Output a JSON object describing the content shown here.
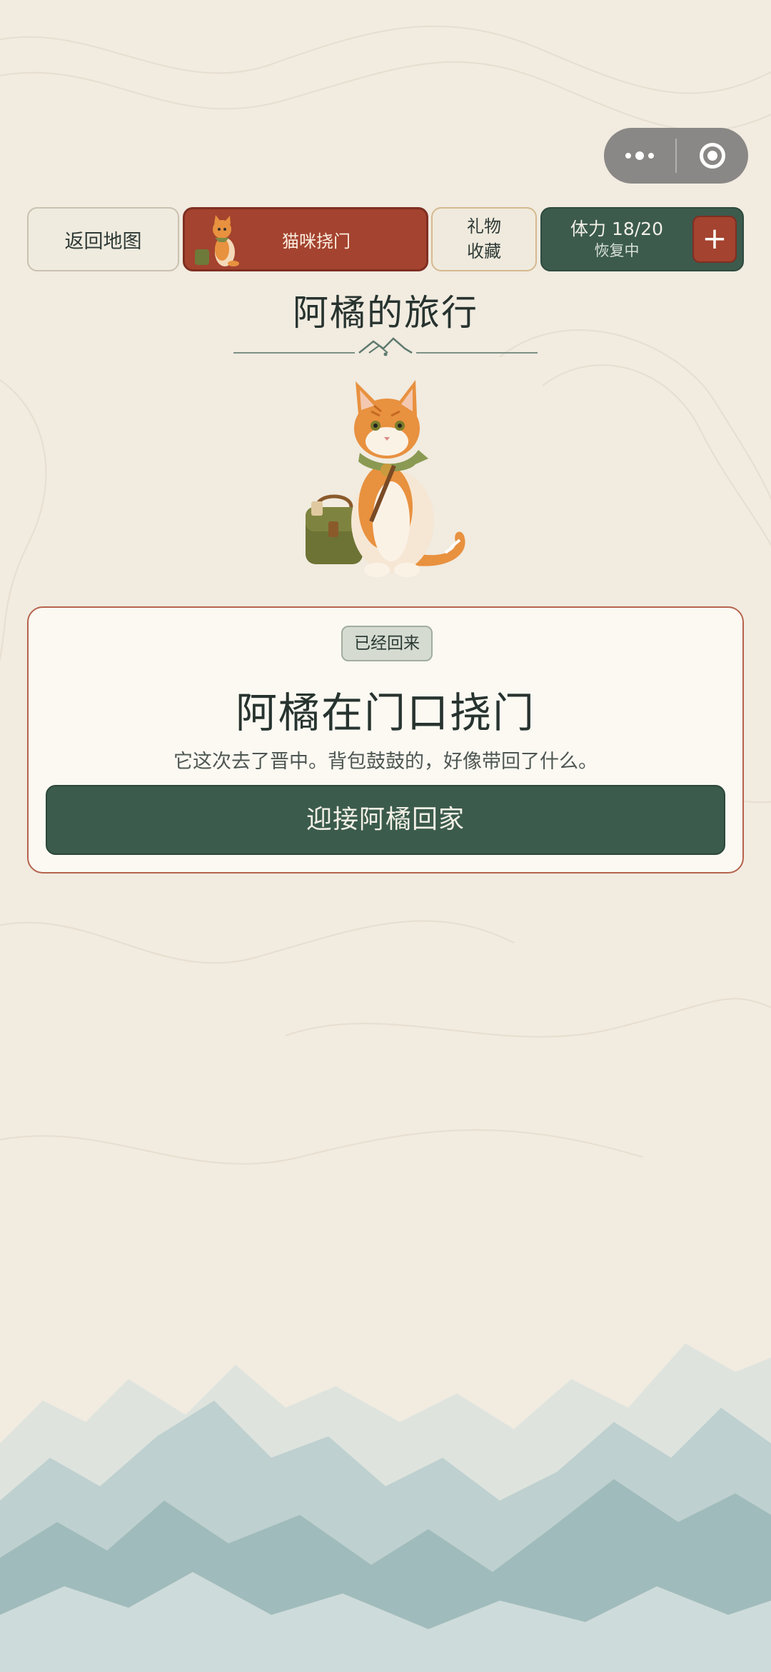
{
  "capsule": {
    "more_icon": "more-dots-icon",
    "close_icon": "target-circle-icon"
  },
  "nav": {
    "back_label": "返回地图",
    "cat_label": "猫咪挠门",
    "gift_line1": "礼物",
    "gift_line2": "收藏",
    "stamina_label": "体力 18/20",
    "stamina_status": "恢复中",
    "plus_label": "+"
  },
  "page": {
    "title": "阿橘的旅行"
  },
  "card": {
    "badge": "已经回来",
    "title": "阿橘在门口挠门",
    "description": "它这次去了晋中。背包鼓鼓的，好像带回了什么。",
    "action_label": "迎接阿橘回家"
  },
  "colors": {
    "background": "#f1ebe0",
    "accent_red": "#a4432f",
    "accent_green": "#3b5b4c",
    "text_dark": "#27332f"
  }
}
